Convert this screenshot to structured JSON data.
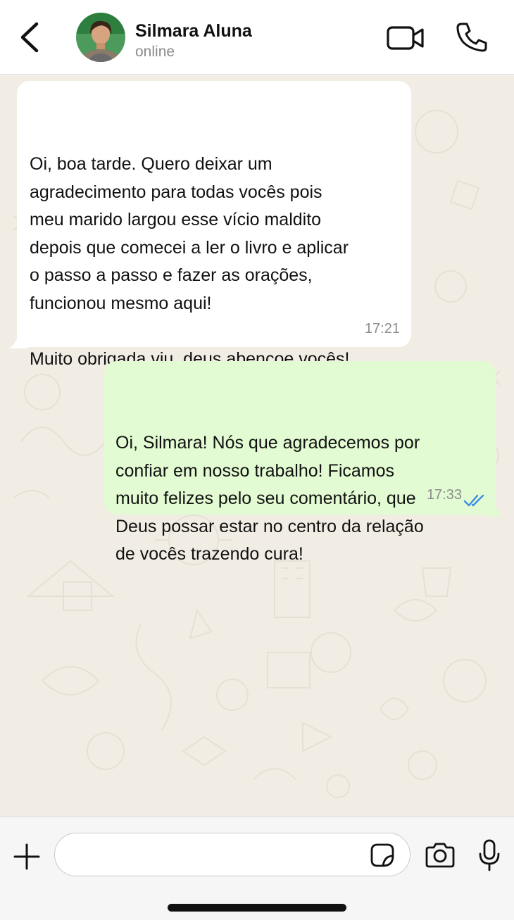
{
  "header": {
    "contact_name": "Silmara Aluna",
    "status": "online"
  },
  "messages": [
    {
      "direction": "incoming",
      "text": "Oi, boa tarde. Quero deixar um\nagradecimento para todas vocês pois\nmeu marido largou esse vício maldito\ndepois que comecei a ler o livro e aplicar\no passo a passo e fazer as orações,\nfuncionou mesmo aqui!\n\nMuito obrigada viu, deus abençoe vocês!",
      "time": "17:21"
    },
    {
      "direction": "outgoing",
      "text": "Oi, Silmara! Nós que agradecemos por\nconfiar em nosso trabalho! Ficamos\nmuito felizes pelo seu comentário, que\nDeus possar estar no centro da relação\nde vocês trazendo cura!",
      "time": "17:33",
      "status_icon": "double-check-read-icon"
    }
  ],
  "composer": {
    "value": "",
    "placeholder": ""
  },
  "colors": {
    "chat_background": "#f2ede4",
    "incoming_bubble": "#ffffff",
    "outgoing_bubble": "#e2fbd2",
    "read_ticks": "#3a8ee6"
  }
}
